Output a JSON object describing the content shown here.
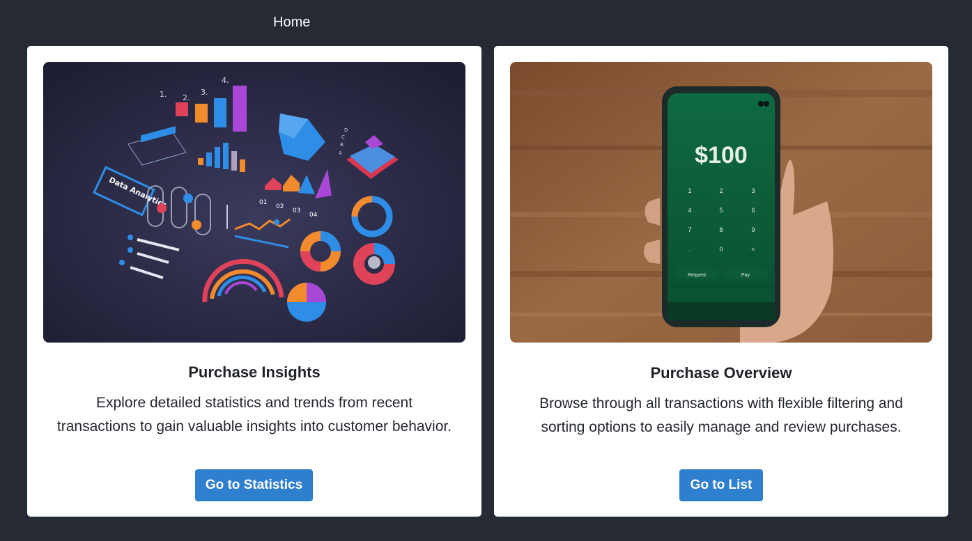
{
  "nav": {
    "home_label": "Home"
  },
  "cards": [
    {
      "title": "Purchase Insights",
      "description_line1": "Explore detailed statistics and trends from recent",
      "description_line2": "transactions to gain valuable insights into customer behavior.",
      "button_label": "Go to Statistics",
      "image": {
        "type": "illustration",
        "badge_text": "Data Analytics",
        "rank_labels": [
          "1.",
          "2.",
          "3.",
          "4."
        ],
        "period_labels": [
          "01",
          "02",
          "03",
          "04"
        ],
        "pyramid_labels": [
          "D",
          "C",
          "B",
          "A"
        ]
      }
    },
    {
      "title": "Purchase Overview",
      "description_line1": "Browse through all transactions with flexible filtering and",
      "description_line2": "sorting options to easily manage and review purchases.",
      "button_label": "Go to List",
      "image": {
        "type": "photo",
        "phone_amount": "$100",
        "keypad": [
          "1",
          "2",
          "3",
          "4",
          "5",
          "6",
          "7",
          "8",
          "9",
          ".",
          "0",
          "<"
        ],
        "request_label": "Request",
        "pay_label": "Pay"
      }
    }
  ],
  "colors": {
    "background": "#262a33",
    "card": "#ffffff",
    "button": "#2f7fcf",
    "phone_screen": "#0b5a36"
  }
}
